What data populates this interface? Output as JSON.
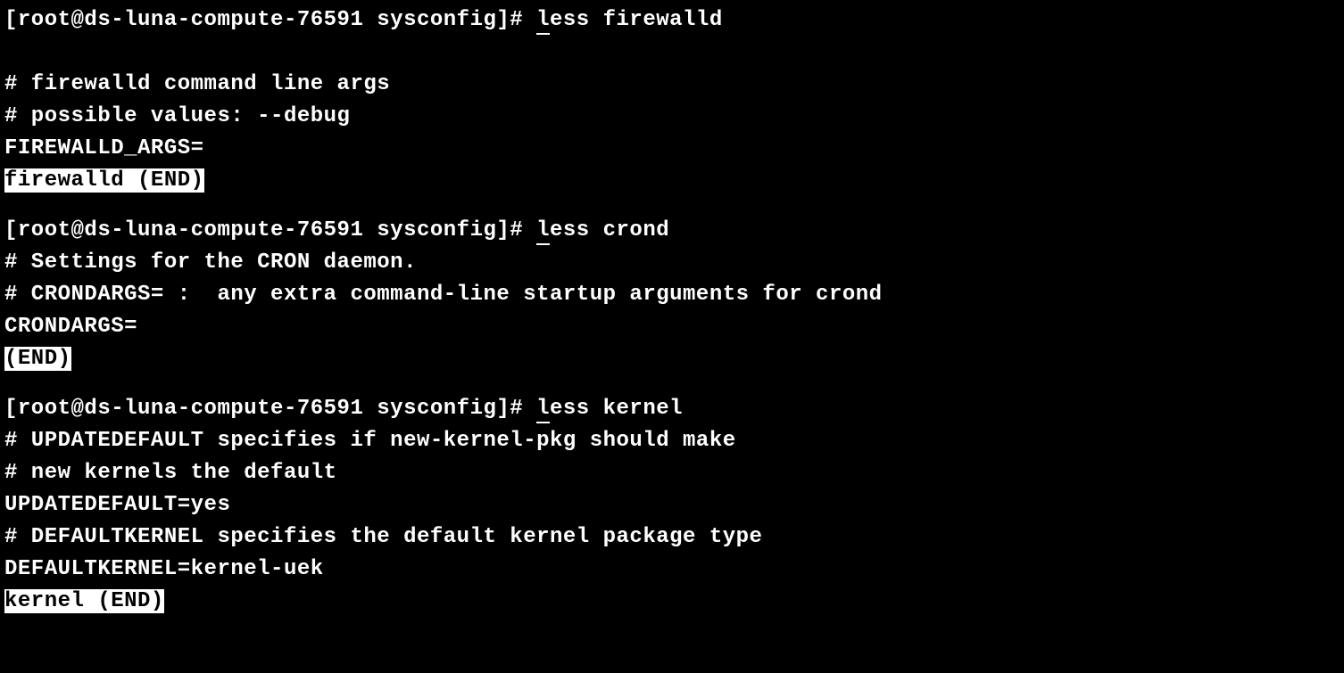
{
  "prompt": "[root@ds-luna-compute-76591 sysconfig]# ",
  "cmd_prefix": "l",
  "cmd_rest1": "ess firewalld",
  "cmd_rest2": "ess crond",
  "cmd_rest3": "ess kernel",
  "session1": {
    "lines": [
      "# firewalld command line args",
      "# possible values: --debug",
      "FIREWALLD_ARGS="
    ],
    "end": "firewalld (END)"
  },
  "session2": {
    "lines": [
      "# Settings for the CRON daemon.",
      "# CRONDARGS= :  any extra command-line startup arguments for crond",
      "CRONDARGS="
    ],
    "end": "(END)"
  },
  "session3": {
    "lines": [
      "# UPDATEDEFAULT specifies if new-kernel-pkg should make",
      "# new kernels the default",
      "UPDATEDEFAULT=yes",
      "",
      "# DEFAULTKERNEL specifies the default kernel package type",
      "DEFAULTKERNEL=kernel-uek"
    ],
    "end": "kernel (END)"
  }
}
